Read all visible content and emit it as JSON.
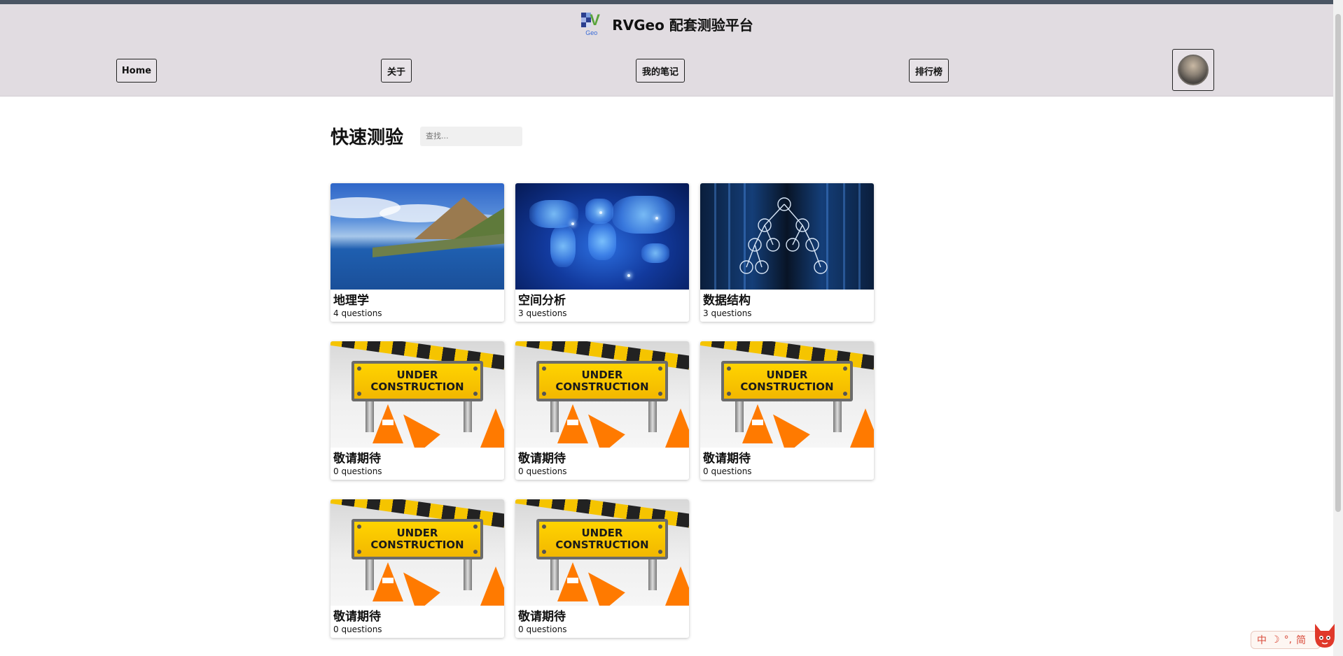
{
  "site": {
    "title": "RVGeo 配套测验平台",
    "logo_letter": "V",
    "logo_caption": "Geo"
  },
  "nav": {
    "items": [
      {
        "label": "Home"
      },
      {
        "label": "关于"
      },
      {
        "label": "我的笔记"
      },
      {
        "label": "排行榜"
      }
    ]
  },
  "main": {
    "title": "快速测验",
    "search_placeholder": "查找..."
  },
  "quizzes": [
    {
      "title": "地理学",
      "count": "4 questions",
      "image": "mountain-lake-image"
    },
    {
      "title": "空间分析",
      "count": "3 questions",
      "image": "world-map-network-image"
    },
    {
      "title": "数据结构",
      "count": "3 questions",
      "image": "tree-structure-image"
    },
    {
      "title": "敬请期待",
      "count": "0 questions",
      "image": "under-construction-image"
    },
    {
      "title": "敬请期待",
      "count": "0 questions",
      "image": "under-construction-image"
    },
    {
      "title": "敬请期待",
      "count": "0 questions",
      "image": "under-construction-image"
    },
    {
      "title": "敬请期待",
      "count": "0 questions",
      "image": "under-construction-image"
    },
    {
      "title": "敬请期待",
      "count": "0 questions",
      "image": "under-construction-image"
    }
  ],
  "under_construction_sign": {
    "line1": "UNDER",
    "line2": "CONSTRUCTION"
  },
  "ime": {
    "mode": "中",
    "extra": "简"
  },
  "colors": {
    "header_bg": "#e1dce1",
    "sign_yellow": "#ffd400",
    "cone_orange": "#ff7a00"
  }
}
